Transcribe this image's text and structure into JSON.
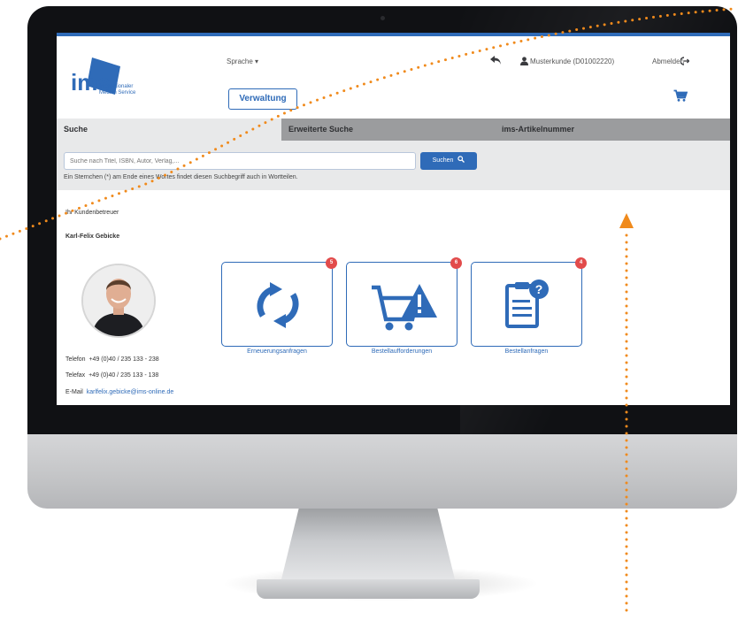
{
  "header": {
    "logo_text": "ims",
    "logo_subtitle_1": "Internationaler",
    "logo_subtitle_2": "Medien Service",
    "language_label": "Sprache ▾",
    "admin_button": "Verwaltung",
    "user_label": "Musterkunde (D01002220)",
    "logout_label": "Abmelden"
  },
  "tabs": [
    {
      "label": "Suche",
      "active": true
    },
    {
      "label": "Erweiterte Suche",
      "active": false
    },
    {
      "label": "ims-Artikelnummer",
      "active": false
    }
  ],
  "search": {
    "placeholder": "Suche nach Titel, ISBN, Autor, Verlag,...",
    "button_label": "Suchen",
    "hint": "Ein Sternchen (*) am Ende eines Wortes findet diesen Suchbegriff auch in Wortteilen."
  },
  "contact": {
    "heading": "Ihr Kundenbetreuer",
    "name": "Karl-Felix Gebicke",
    "phone_label": "Telefon",
    "phone": "+49 (0)40 / 235 133 - 238",
    "fax_label": "Telefax",
    "fax": "+49 (0)40 / 235 133 - 138",
    "email_label": "E-Mail",
    "email": "karlfelix.gebicke@ims-online.de"
  },
  "cards": [
    {
      "label": "Erneuerungsanfragen",
      "badge": "5",
      "icon": "refresh-icon"
    },
    {
      "label": "Bestellaufforderungen",
      "badge": "6",
      "icon": "cart-warning-icon"
    },
    {
      "label": "Bestellanfragen",
      "badge": "4",
      "icon": "clipboard-question-icon"
    }
  ],
  "colors": {
    "accent": "#2f6bb8",
    "badge": "#e24b4b",
    "dotted_line": "#f08a1c",
    "tab_bar": "#9b9c9e",
    "panel": "#e8e9ea"
  }
}
